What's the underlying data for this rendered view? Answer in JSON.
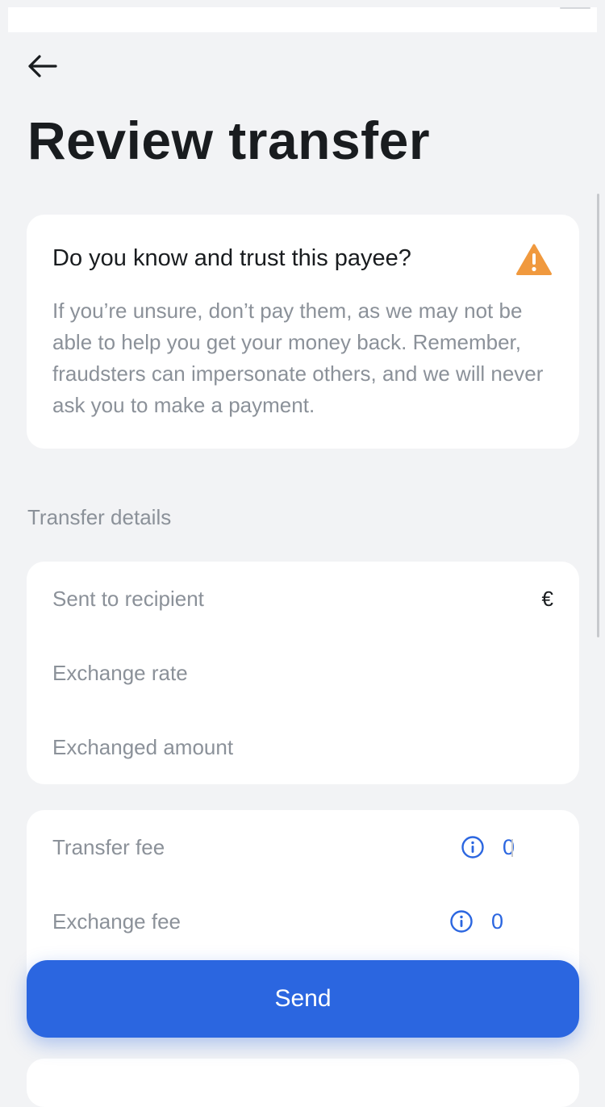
{
  "header": {
    "back_icon": "arrow-left-icon",
    "title": "Review transfer"
  },
  "warning": {
    "title": "Do you know and trust this payee?",
    "icon": "warning-triangle-icon",
    "icon_color": "#f0993e",
    "body": "If you’re unsure, don’t pay them, as we may not be able to help you get your money back. Remember, fraudsters can impersonate others, and we will never ask you to make a payment."
  },
  "transfer_details": {
    "section_label": "Transfer details",
    "rows": [
      {
        "label": "Sent to recipient",
        "value": "€"
      },
      {
        "label": "Exchange rate",
        "value": ""
      },
      {
        "label": "Exchanged amount",
        "value": ""
      }
    ]
  },
  "fees": {
    "rows": [
      {
        "label": "Transfer fee",
        "value": "0",
        "icon": "info-icon"
      },
      {
        "label": "Exchange fee",
        "value": "0",
        "icon": "info-icon"
      }
    ]
  },
  "actions": {
    "send_label": "Send"
  },
  "colors": {
    "background": "#f2f3f5",
    "accent": "#2b66e0",
    "muted_text": "#8b9199",
    "warning": "#f0993e"
  }
}
